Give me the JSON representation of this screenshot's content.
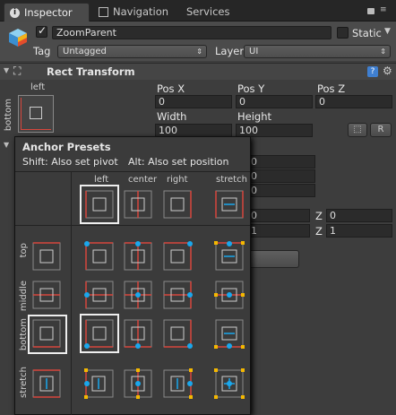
{
  "tabs": [
    {
      "label": "Inspector",
      "active": true
    },
    {
      "label": "Navigation",
      "active": false
    },
    {
      "label": "Services",
      "active": false
    }
  ],
  "object": {
    "name": "ZoomParent",
    "active": true,
    "static_label": "Static",
    "tag_label": "Tag",
    "tag_value": "Untagged",
    "layer_label": "Layer",
    "layer_value": "UI"
  },
  "rect_transform": {
    "title": "Rect Transform",
    "anchor_label_top": "left",
    "anchor_label_side": "bottom",
    "pos_x_label": "Pos X",
    "pos_y_label": "Pos Y",
    "pos_z_label": "Pos Z",
    "pos_x": "0",
    "pos_y": "0",
    "pos_z": "0",
    "width_label": "Width",
    "height_label": "Height",
    "width": "100",
    "height": "100",
    "raw_button": "R",
    "hidden_rows": [
      "0",
      "0",
      "0"
    ],
    "row_rotation": {
      "value": "0",
      "z_label": "Z",
      "z_value": "0"
    },
    "row_scale": {
      "value": "1",
      "z_label": "Z",
      "z_value": "1"
    }
  },
  "anchor_presets": {
    "title": "Anchor Presets",
    "hint_shift": "Shift: Also set pivot",
    "hint_alt": "Alt: Also set position",
    "columns": [
      "left",
      "center",
      "right",
      "stretch"
    ],
    "rows": [
      "top",
      "middle",
      "bottom",
      "stretch"
    ]
  },
  "colors": {
    "accent_red": "#d8463d",
    "pivot_blue": "#1aa7ec",
    "stretch_yellow": "#f5b800"
  }
}
